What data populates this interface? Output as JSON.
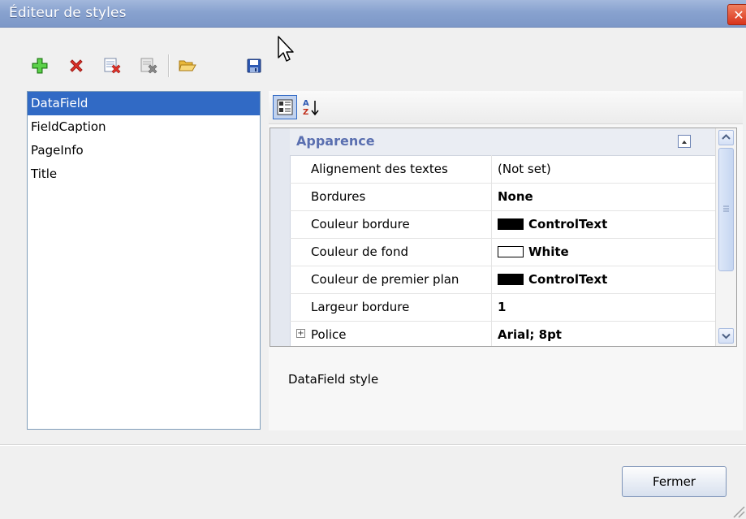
{
  "window": {
    "title": "Éditeur de styles",
    "close_glyph": "✕"
  },
  "toolbar": {
    "buttons": [
      {
        "icon": "add-icon"
      },
      {
        "icon": "delete-icon"
      },
      {
        "icon": "delete-style-icon"
      },
      {
        "icon": "delete-all-icon"
      },
      {
        "icon": "open-folder-icon"
      },
      {
        "icon": "save-icon"
      }
    ]
  },
  "styles_list": {
    "items": [
      "DataField",
      "FieldCaption",
      "PageInfo",
      "Title"
    ],
    "selected": "DataField"
  },
  "property_grid": {
    "toolbar": [
      {
        "icon": "categorized-view-icon",
        "active": true
      },
      {
        "icon": "alphabetical-sort-icon",
        "active": false
      }
    ],
    "category": "Apparence",
    "rows": [
      {
        "name": "Alignement des textes",
        "value": "(Not set)",
        "bold": false,
        "swatch": null
      },
      {
        "name": "Bordures",
        "value": "None",
        "bold": true,
        "swatch": null
      },
      {
        "name": "Couleur bordure",
        "value": "ControlText",
        "bold": true,
        "swatch": "#000000"
      },
      {
        "name": "Couleur de fond",
        "value": "White",
        "bold": true,
        "swatch": "#ffffff"
      },
      {
        "name": "Couleur de premier plan",
        "value": "ControlText",
        "bold": true,
        "swatch": "#000000"
      },
      {
        "name": "Largeur bordure",
        "value": "1",
        "bold": true,
        "swatch": null
      },
      {
        "name": "Police",
        "value": "Arial; 8pt",
        "bold": true,
        "swatch": null,
        "expandable": true
      }
    ],
    "description": "DataField style"
  },
  "footer": {
    "close_label": "Fermer"
  },
  "colors": {
    "selection": "#316ac5",
    "titlebar": "#88a2cf",
    "category_text": "#5a6fb0"
  }
}
